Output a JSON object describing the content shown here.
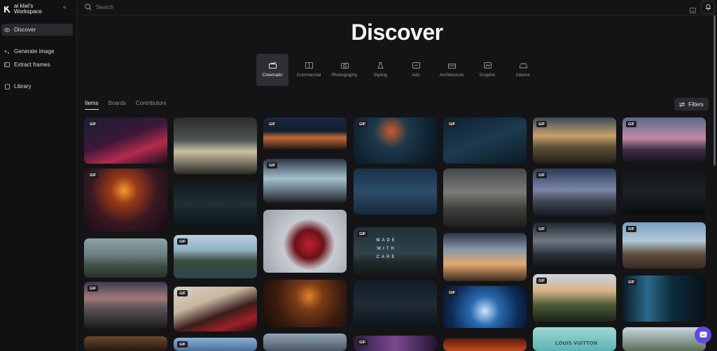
{
  "workspace": {
    "name": "ai kiwi's Workspace"
  },
  "sidebar": {
    "collapse_icon": "chevrons-left-icon",
    "items": [
      {
        "label": "Discover",
        "icon": "eye-icon",
        "active": true
      },
      {
        "label": "Generate image",
        "icon": "sparkle-icon",
        "active": false
      },
      {
        "label": "Extract frames",
        "icon": "frames-icon",
        "active": false
      },
      {
        "label": "Library",
        "icon": "book-icon",
        "active": false
      }
    ]
  },
  "search": {
    "placeholder": "Search"
  },
  "page": {
    "title": "Discover"
  },
  "categories": [
    {
      "label": "Cinematic",
      "icon": "clapperboard-icon",
      "active": true
    },
    {
      "label": "Commercial",
      "icon": "commercial-icon",
      "active": false
    },
    {
      "label": "Photography",
      "icon": "camera-icon",
      "active": false
    },
    {
      "label": "Styling",
      "icon": "dress-icon",
      "active": false
    },
    {
      "label": "Ads",
      "icon": "ads-icon",
      "active": false
    },
    {
      "label": "Architecture",
      "icon": "building-icon",
      "active": false
    },
    {
      "label": "Graphic",
      "icon": "graphic-icon",
      "active": false
    },
    {
      "label": "Interior",
      "icon": "sofa-icon",
      "active": false
    }
  ],
  "tabs": [
    {
      "label": "Items",
      "active": true
    },
    {
      "label": "Boards",
      "active": false
    },
    {
      "label": "Contributors",
      "active": false
    }
  ],
  "filters": {
    "label": "Filters"
  },
  "badge": {
    "gif": "GIF"
  },
  "overlays": {
    "made_with_care": "MADE WITH CARE",
    "brand": "LOUIS VUITTON"
  },
  "colors": {
    "accent": "#5b4be0",
    "background": "#141416",
    "sidebar": "#111113"
  }
}
